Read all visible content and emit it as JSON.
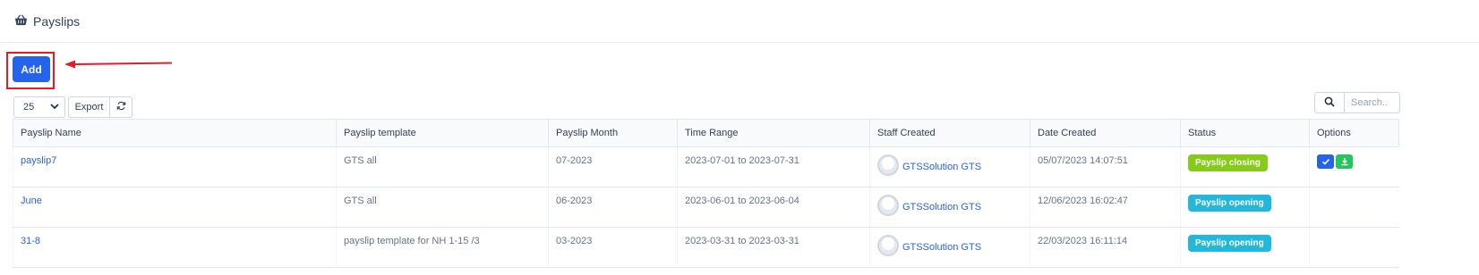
{
  "header": {
    "title": "Payslips",
    "icon": "basket-icon"
  },
  "toolbar": {
    "add_label": "Add",
    "page_size": "25",
    "export_label": "Export",
    "search_placeholder": "Search.."
  },
  "table": {
    "columns": [
      "Payslip Name",
      "Payslip template",
      "Payslip Month",
      "Time Range",
      "Staff Created",
      "Date Created",
      "Status",
      "Options"
    ],
    "rows": [
      {
        "name": "payslip7",
        "template": "GTS all",
        "month": "07-2023",
        "range": "2023-07-01 to 2023-07-31",
        "staff": "GTSSolution GTS",
        "created": "05/07/2023 14:07:51",
        "status": "Payslip closing"
      },
      {
        "name": "June",
        "template": "GTS all",
        "month": "06-2023",
        "range": "2023-06-01 to 2023-06-04",
        "staff": "GTSSolution GTS",
        "created": "12/06/2023 16:02:47",
        "status": "Payslip opening"
      },
      {
        "name": "31-8",
        "template": "payslip template for NH 1-15 /3",
        "month": "03-2023",
        "range": "2023-03-31 to 2023-03-31",
        "staff": "GTSSolution GTS",
        "created": "22/03/2023 16:11:14",
        "status": "Payslip opening"
      }
    ]
  },
  "colors": {
    "primary": "#2563eb",
    "closing": "#84cc16",
    "opening": "#22b8db",
    "download": "#22c55e",
    "highlight": "#e11d26"
  }
}
